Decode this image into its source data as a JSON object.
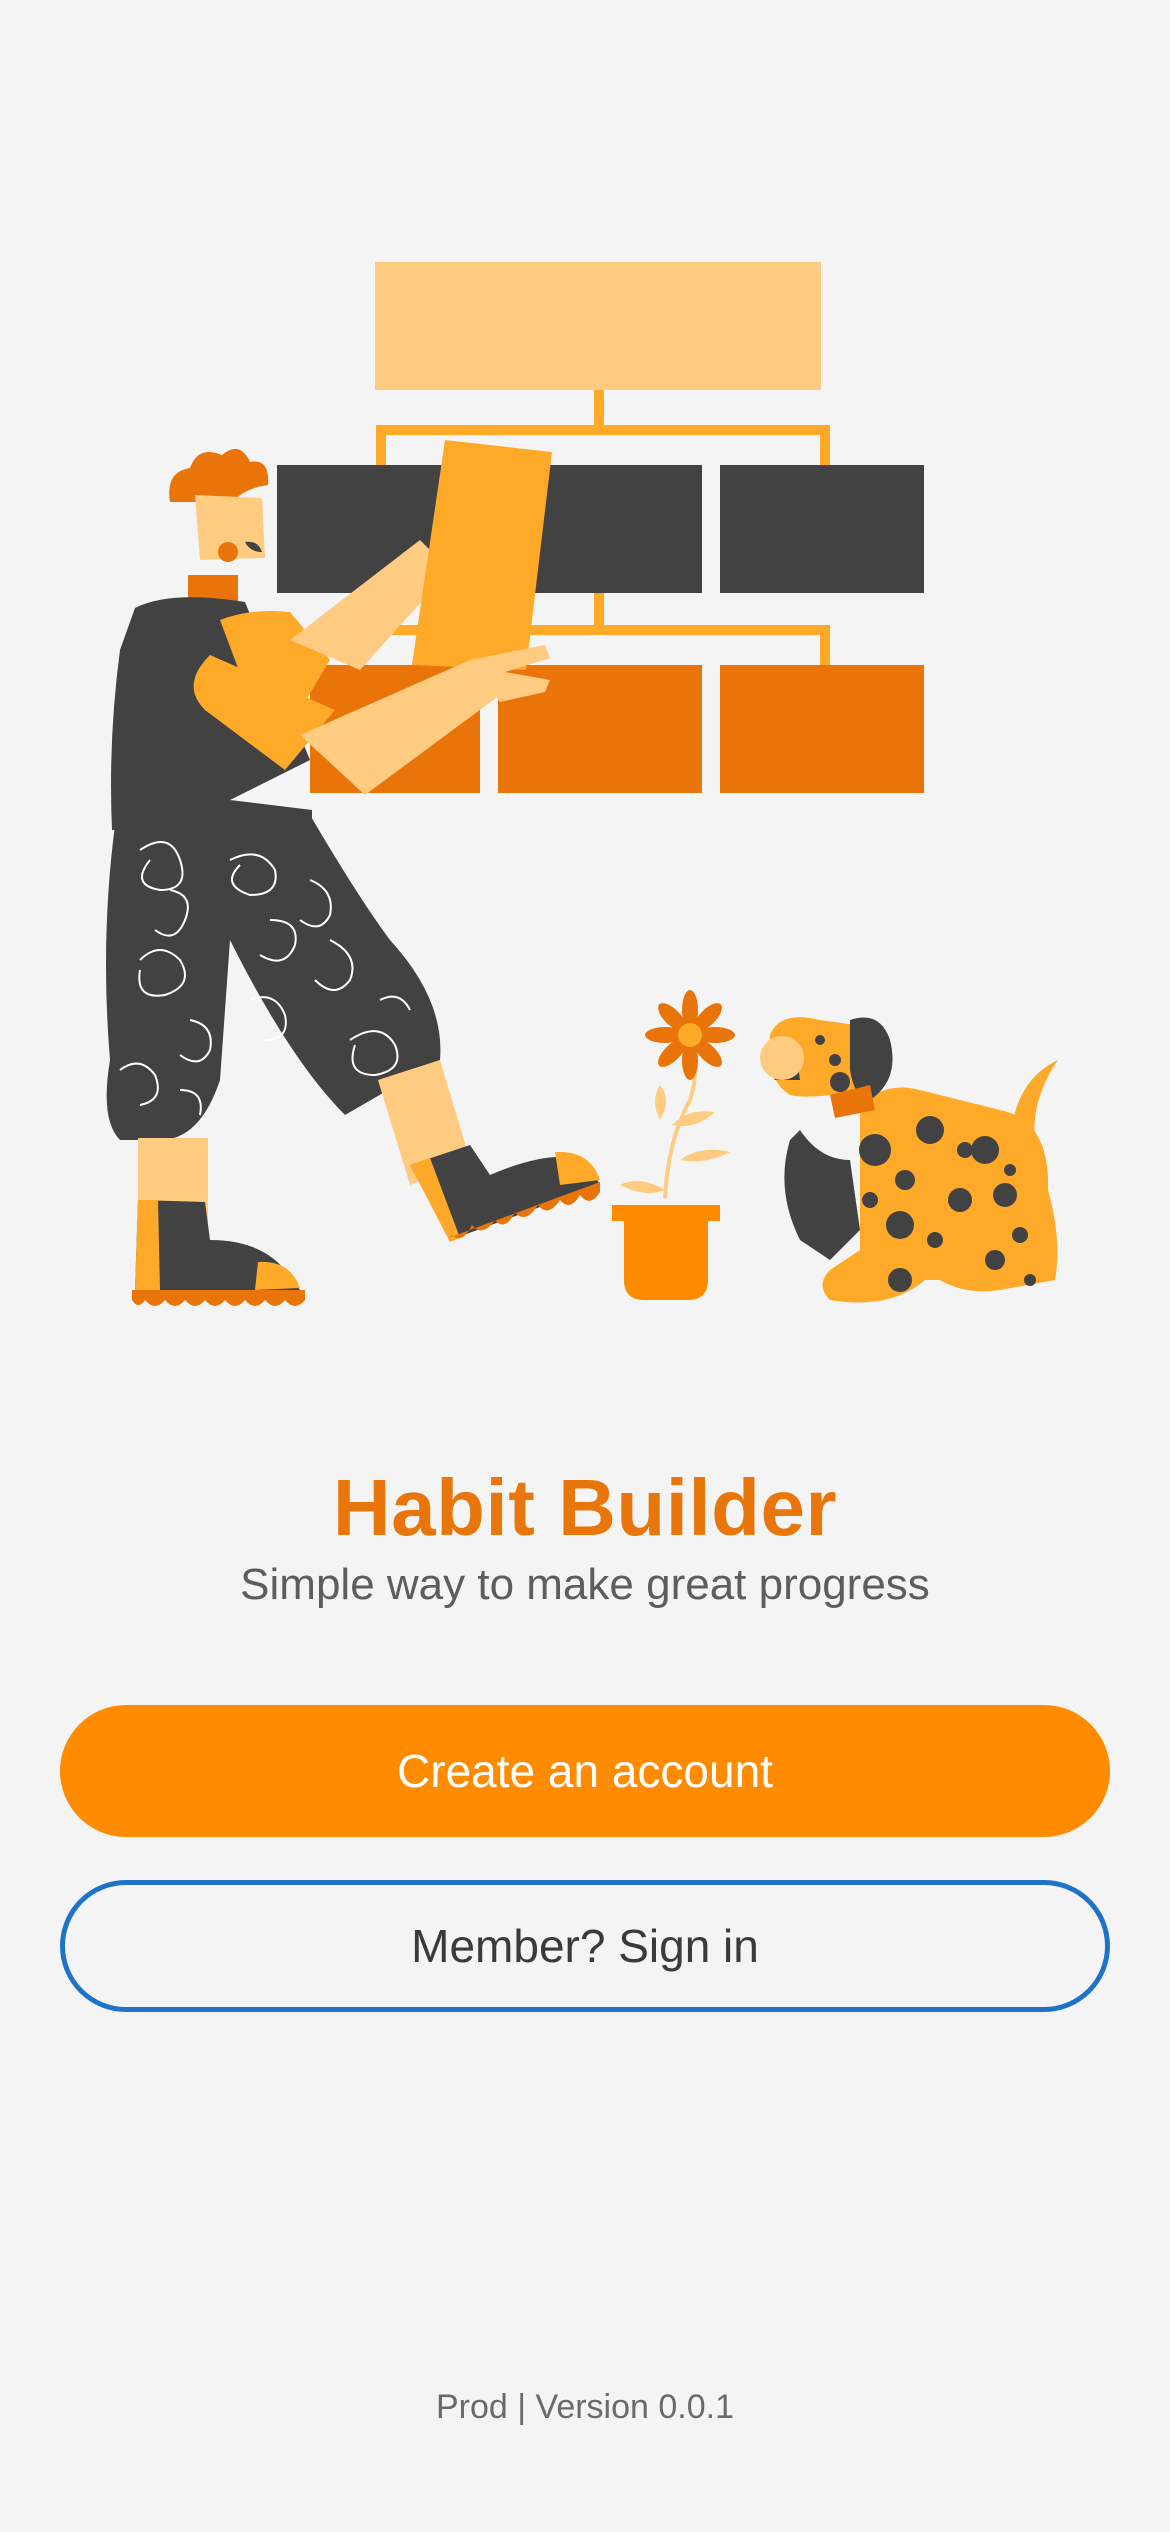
{
  "app": {
    "title": "Habit Builder",
    "subtitle": "Simple way to make great progress"
  },
  "actions": {
    "create_account_label": "Create an account",
    "sign_in_label": "Member? Sign in"
  },
  "footer": {
    "version_text": "Prod | Version 0.0.1"
  },
  "illustration": {
    "name": "person-building-habit-blocks-with-dog-illustration"
  },
  "colors": {
    "background": "#f4f4f4",
    "brand_orange": "#ff8c00",
    "title_orange": "#e8760a",
    "outline_blue": "#1e73c8",
    "dark_gray": "#424242"
  }
}
